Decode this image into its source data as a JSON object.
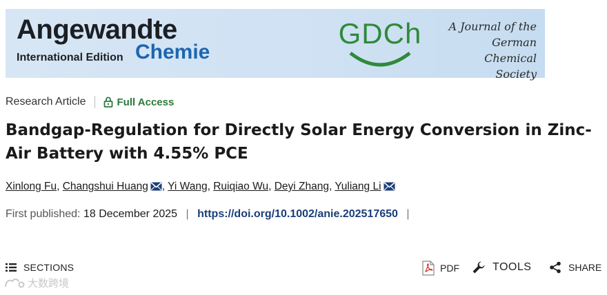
{
  "banner": {
    "brand_main": "Angewandte",
    "brand_edition": "International Edition",
    "brand_chemie": "Chemie",
    "gdch_logo": "GDCh",
    "society_lines": [
      "A Journal of the",
      "German",
      "Chemical Society"
    ]
  },
  "article": {
    "type": "Research Article",
    "access_label": "Full Access",
    "title": "Bandgap-Regulation for Directly Solar Energy Conversion in Zinc-Air Battery with 4.55% PCE",
    "authors": [
      {
        "name": "Xinlong Fu",
        "corresponding": false
      },
      {
        "name": "Changshui Huang",
        "corresponding": true
      },
      {
        "name": "Yi Wang",
        "corresponding": false
      },
      {
        "name": "Ruiqiao Wu",
        "corresponding": false
      },
      {
        "name": "Deyi Zhang",
        "corresponding": false
      },
      {
        "name": "Yuliang Li",
        "corresponding": true
      }
    ],
    "first_published_label": "First published:",
    "first_published_date": "18 December 2025",
    "doi_link": "https://doi.org/10.1002/anie.202517650",
    "separator": "|"
  },
  "toolbar": {
    "sections_label": "SECTIONS",
    "pdf_label": "PDF",
    "tools_label": "TOOLS",
    "share_label": "SHARE"
  },
  "watermark": {
    "text": "大数跨境"
  },
  "icons": {
    "lock": "lock-icon",
    "mail": "mail-icon",
    "list": "list-icon",
    "pdf": "pdf-icon",
    "wrench": "wrench-icon",
    "share": "share-icon"
  },
  "colors": {
    "banner_bg": "#d3e4f4",
    "chemie_blue": "#1d66b0",
    "gdch_green": "#2f8a3a",
    "access_green": "#2a7a3c",
    "doi_blue": "#1a3e78",
    "pdf_red": "#d23a2a"
  }
}
